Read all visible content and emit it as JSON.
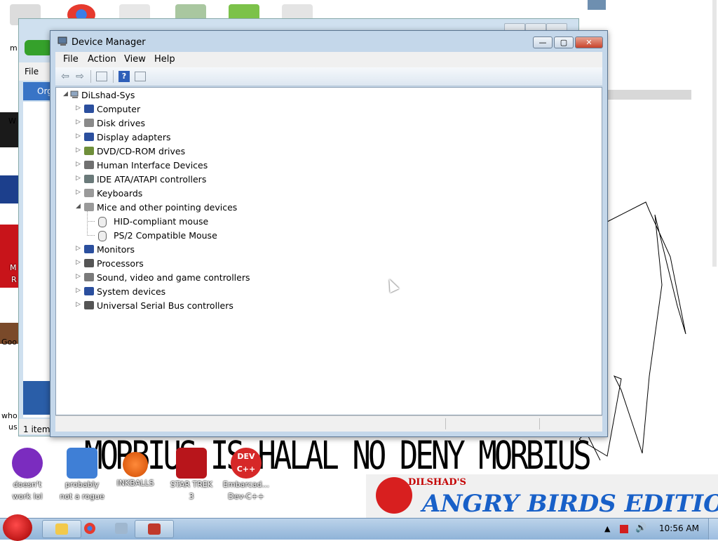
{
  "desktop": {
    "side_text_1": "W",
    "side_text_2": "M",
    "side_text_3": "R",
    "side_text_4": "Goo",
    "side_text_5": "who",
    "side_text_6": "us",
    "side_text_7": "m",
    "meme_text": "MORBIUS IS HALAL NO DENY MORBIUS",
    "banner_top": "DILSHAD'S",
    "banner_main": "ANGRY BIRDS EDITION",
    "icons": [
      {
        "name": "yahoo-messenger",
        "line1": "doesn't",
        "line2": "work lol",
        "color": "#7b2cbf"
      },
      {
        "name": "control-panel",
        "line1": "probably",
        "line2": "not a rogue",
        "color": "#3f7fd6"
      },
      {
        "name": "inkballs",
        "line1": "INKBALLS",
        "line2": "",
        "color": "#e8641c"
      },
      {
        "name": "star-trek",
        "line1": "STAR TREK",
        "line2": "3",
        "color": "#b8151b"
      },
      {
        "name": "dev-cpp",
        "line1": "Embarcad...",
        "line2": "Dev-C++",
        "color": "#d62828"
      }
    ],
    "dev_icon_text": "DEV\nC++"
  },
  "back_window": {
    "file_menu": "File",
    "organize": "Org",
    "status": "1 item"
  },
  "device_manager": {
    "title": "Device Manager",
    "buttons": {
      "minimize": "—",
      "maximize": "▢",
      "close": "✕"
    },
    "menu": [
      "File",
      "Action",
      "View",
      "Help"
    ],
    "root": "DiLshad-Sys",
    "nodes": [
      {
        "label": "Computer",
        "expanded": false,
        "icon_color": "#2b4f9e"
      },
      {
        "label": "Disk drives",
        "expanded": false,
        "icon_color": "#8a8a8a"
      },
      {
        "label": "Display adapters",
        "expanded": false,
        "icon_color": "#2b4f9e"
      },
      {
        "label": "DVD/CD-ROM drives",
        "expanded": false,
        "icon_color": "#6f8f3a"
      },
      {
        "label": "Human Interface Devices",
        "expanded": false,
        "icon_color": "#707070"
      },
      {
        "label": "IDE ATA/ATAPI controllers",
        "expanded": false,
        "icon_color": "#6a7a7a"
      },
      {
        "label": "Keyboards",
        "expanded": false,
        "icon_color": "#9a9a9a"
      },
      {
        "label": "Mice and other pointing devices",
        "expanded": true,
        "icon_color": "#9a9a9a",
        "children": [
          "HID-compliant mouse",
          "PS/2 Compatible Mouse"
        ]
      },
      {
        "label": "Monitors",
        "expanded": false,
        "icon_color": "#2b4f9e"
      },
      {
        "label": "Processors",
        "expanded": false,
        "icon_color": "#555555"
      },
      {
        "label": "Sound, video and game controllers",
        "expanded": false,
        "icon_color": "#7a7a7a"
      },
      {
        "label": "System devices",
        "expanded": false,
        "icon_color": "#2b4f9e"
      },
      {
        "label": "Universal Serial Bus controllers",
        "expanded": false,
        "icon_color": "#555555"
      }
    ]
  },
  "taskbar": {
    "time": "10:56 AM",
    "apps": [
      "explorer",
      "chrome",
      "network",
      "device-manager"
    ]
  }
}
